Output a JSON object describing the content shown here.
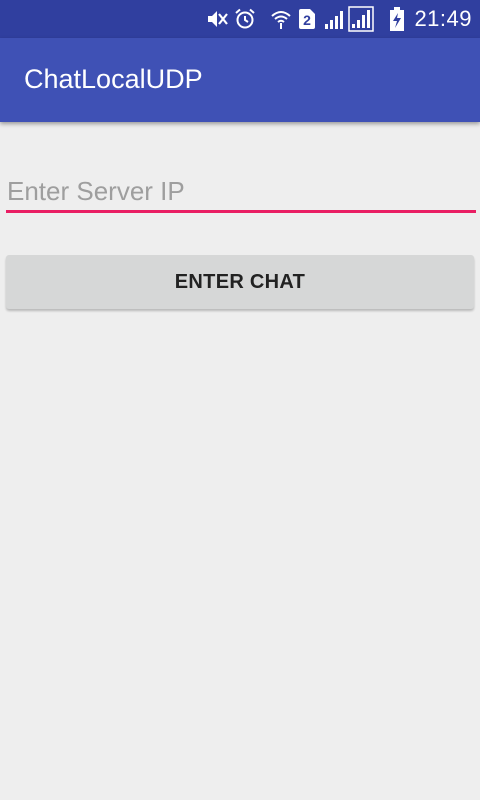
{
  "status_bar": {
    "time": "21:49",
    "sim_badge": "2",
    "icons": [
      "mute-icon",
      "alarm-icon",
      "wifi-icon",
      "sim2-icon",
      "signal-icon",
      "signal-icon-2",
      "battery-charging-icon"
    ],
    "background": "#303f9f"
  },
  "app_bar": {
    "title": "ChatLocalUDP",
    "background": "#3f51b5"
  },
  "form": {
    "server_ip_placeholder": "Enter Server IP",
    "server_ip_value": "",
    "underline_color": "#e91e63",
    "enter_button_label": "ENTER CHAT"
  }
}
